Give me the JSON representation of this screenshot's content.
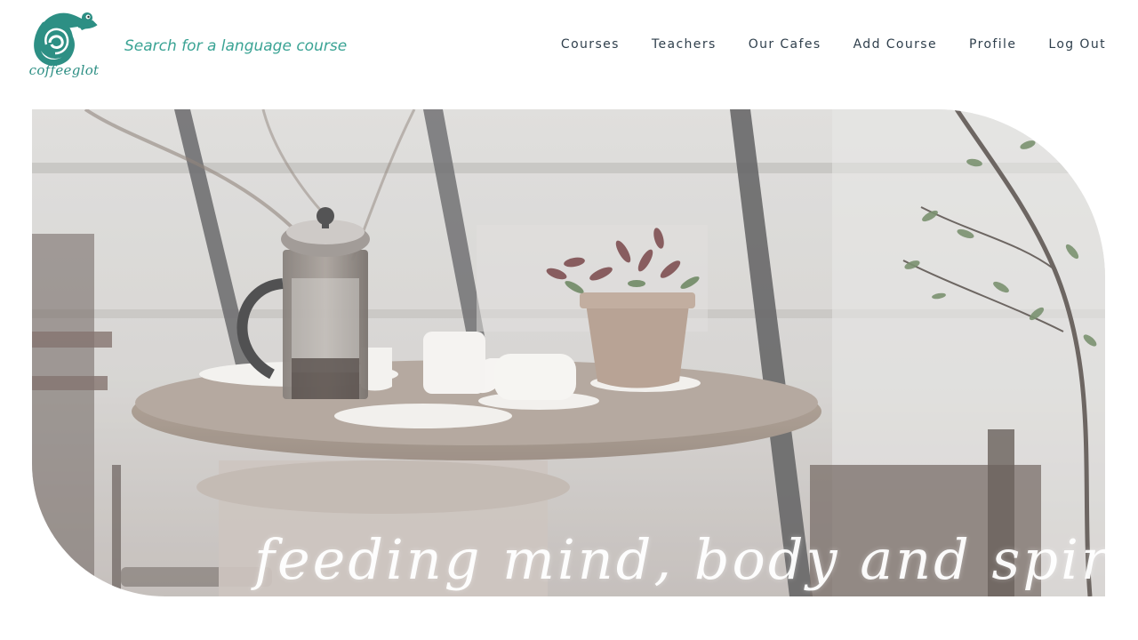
{
  "brand": {
    "name": "coffeeglot",
    "color": "#2d8f84"
  },
  "search": {
    "placeholder": "Search for a language course"
  },
  "nav": {
    "items": [
      {
        "label": "Courses"
      },
      {
        "label": "Teachers"
      },
      {
        "label": "Our Cafes"
      },
      {
        "label": "Add Course"
      },
      {
        "label": "Profile"
      },
      {
        "label": "Log Out"
      }
    ]
  },
  "hero": {
    "tagline": "feeding mind, body and spirit",
    "image": "cafe-table-photo"
  }
}
